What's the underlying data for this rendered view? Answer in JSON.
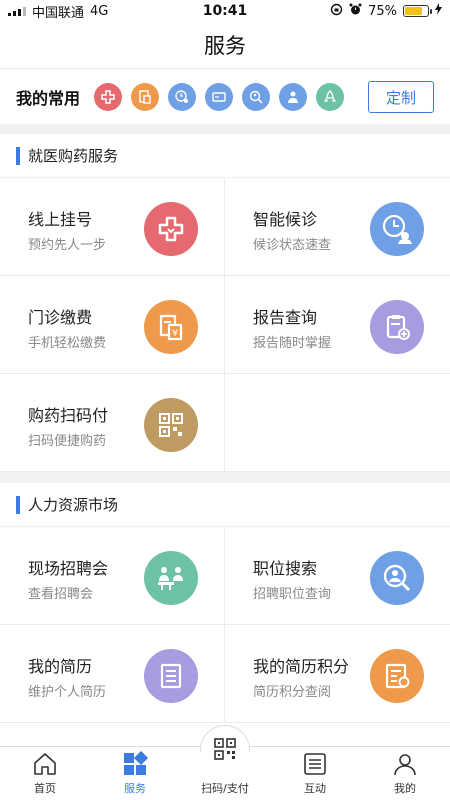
{
  "status_bar": {
    "carrier": "中国联通",
    "network": "4G",
    "time": "10:41",
    "battery": "75%"
  },
  "header": {
    "title": "服务"
  },
  "favorites": {
    "label": "我的常用",
    "customize_label": "定制",
    "icons": [
      {
        "name": "medical-cross-icon",
        "color": "#e56a6f"
      },
      {
        "name": "payment-bill-icon",
        "color": "#ef9a4a"
      },
      {
        "name": "clock-person-icon",
        "color": "#6f9fe5"
      },
      {
        "name": "card-icon",
        "color": "#6f9fe5"
      },
      {
        "name": "search-person-icon",
        "color": "#6f9fe5"
      },
      {
        "name": "recruit-person-icon",
        "color": "#6f9fe5"
      },
      {
        "name": "rocket-icon",
        "color": "#6ec2a4"
      }
    ]
  },
  "sections": {
    "medical": {
      "title": "就医购药服务",
      "items": [
        {
          "title": "线上挂号",
          "subtitle": "预约先人一步",
          "icon": "medical-cross-icon",
          "color": "#e56a6f"
        },
        {
          "title": "智能候诊",
          "subtitle": "候诊状态速查",
          "icon": "clock-person-icon",
          "color": "#6f9fe5"
        },
        {
          "title": "门诊缴费",
          "subtitle": "手机轻松缴费",
          "icon": "payment-bill-icon",
          "color": "#ef9a4a"
        },
        {
          "title": "报告查询",
          "subtitle": "报告随时掌握",
          "icon": "report-clipboard-icon",
          "color": "#a99be0"
        },
        {
          "title": "购药扫码付",
          "subtitle": "扫码便捷购药",
          "icon": "qr-code-icon",
          "color": "#c09a63"
        }
      ]
    },
    "hr": {
      "title": "人力资源市场",
      "items": [
        {
          "title": "现场招聘会",
          "subtitle": "查看招聘会",
          "icon": "job-fair-icon",
          "color": "#6ec2a4"
        },
        {
          "title": "职位搜索",
          "subtitle": "招聘职位查询",
          "icon": "search-person-icon",
          "color": "#6f9fe5"
        },
        {
          "title": "我的简历",
          "subtitle": "维护个人简历",
          "icon": "resume-icon",
          "color": "#a99be0"
        },
        {
          "title": "我的简历积分",
          "subtitle": "简历积分查阅",
          "icon": "resume-points-icon",
          "color": "#ef9a4a"
        }
      ]
    }
  },
  "tabbar": {
    "tabs": [
      {
        "label": "首页",
        "icon": "home-icon"
      },
      {
        "label": "服务",
        "icon": "services-grid-icon",
        "active": true
      },
      {
        "label": "扫码/支付",
        "icon": "qr-code-icon"
      },
      {
        "label": "互动",
        "icon": "list-icon"
      },
      {
        "label": "我的",
        "icon": "person-icon"
      }
    ]
  }
}
